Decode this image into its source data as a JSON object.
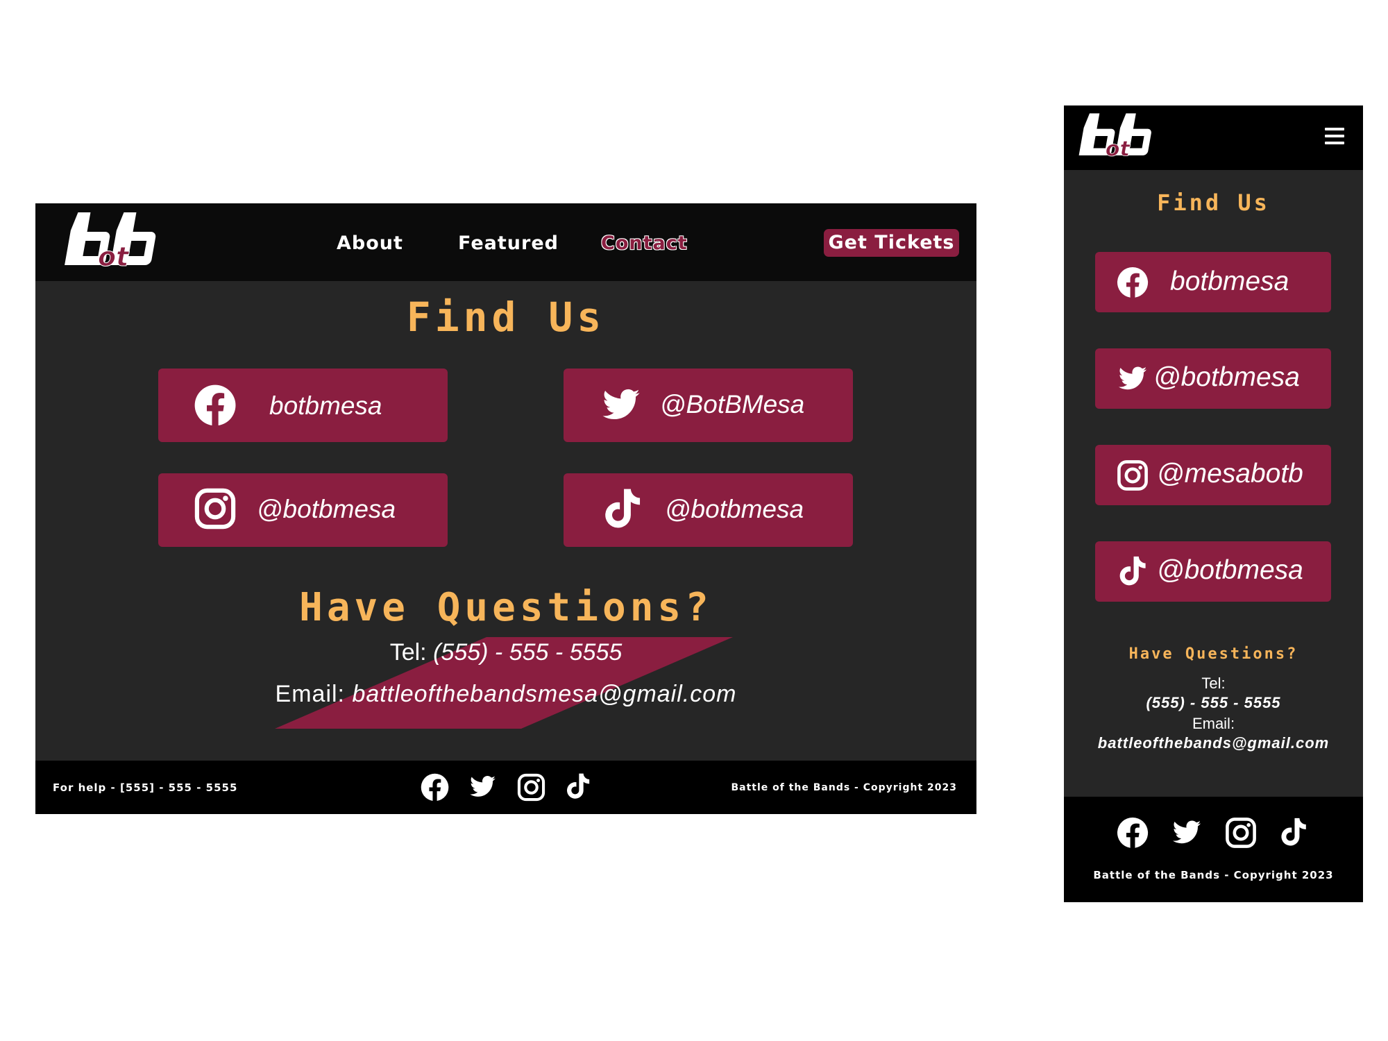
{
  "brand": {
    "logo_text": "bb",
    "logo_subtext": "ot",
    "accent": "#8a1e40",
    "heading_color": "#f7b55a"
  },
  "desktop": {
    "nav": [
      "About",
      "Featured",
      "Contact"
    ],
    "active_nav": "Contact",
    "tickets_label": "Get Tickets",
    "find_us": "Find Us",
    "socials": [
      {
        "icon": "facebook-icon",
        "handle": "botbmesa"
      },
      {
        "icon": "twitter-icon",
        "handle": "@BotBMesa"
      },
      {
        "icon": "instagram-icon",
        "handle": "@botbmesa"
      },
      {
        "icon": "tiktok-icon",
        "handle": "@botbmesa"
      }
    ],
    "questions_heading": "Have Questions?",
    "tel_label": "Tel:",
    "tel_value": "(555) - 555 - 5555",
    "email_label": "Email:",
    "email_value": "battleofthebandsmesa@gmail.com",
    "footer_help": "For help - [555] - 555 - 5555",
    "footer_copyright": "Battle of the Bands - Copyright 2023"
  },
  "mobile": {
    "menu_icon": "hamburger-menu-icon",
    "find_us": "Find Us",
    "socials": [
      {
        "icon": "facebook-icon",
        "handle": "botbmesa"
      },
      {
        "icon": "twitter-icon",
        "handle": "@botbmesa"
      },
      {
        "icon": "instagram-icon",
        "handle": "@mesabotb"
      },
      {
        "icon": "tiktok-icon",
        "handle": "@botbmesa"
      }
    ],
    "questions_heading": "Have Questions?",
    "tel_label": "Tel:",
    "tel_value": "(555) - 555 - 5555",
    "email_label": "Email:",
    "email_value": "battleofthebands@gmail.com",
    "footer_copyright": "Battle of the Bands - Copyright 2023"
  }
}
